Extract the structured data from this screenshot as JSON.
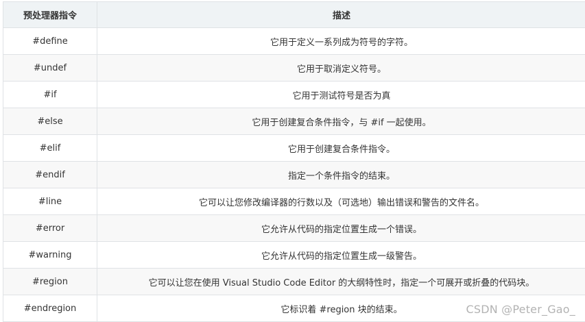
{
  "table": {
    "headers": [
      "预处理器指令",
      "描述"
    ],
    "rows": [
      {
        "directive": "#define",
        "description": "它用于定义一系列成为符号的字符。"
      },
      {
        "directive": "#undef",
        "description": "它用于取消定义符号。"
      },
      {
        "directive": "#if",
        "description": "它用于测试符号是否为真"
      },
      {
        "directive": "#else",
        "description": "它用于创建复合条件指令，与 #if 一起使用。"
      },
      {
        "directive": "#elif",
        "description": "它用于创建复合条件指令。"
      },
      {
        "directive": "#endif",
        "description": "指定一个条件指令的结束。"
      },
      {
        "directive": "#line",
        "description": "它可以让您修改编译器的行数以及（可选地）输出错误和警告的文件名。"
      },
      {
        "directive": "#error",
        "description": "它允许从代码的指定位置生成一个错误。"
      },
      {
        "directive": "#warning",
        "description": "它允许从代码的指定位置生成一级警告。"
      },
      {
        "directive": "#region",
        "description": "它可以让您在使用 Visual Studio Code Editor 的大纲特性时，指定一个可展开或折叠的代码块。"
      },
      {
        "directive": "#endregion",
        "description": "它标识着 #region 块的结束。"
      }
    ]
  },
  "watermark": "CSDN @Peter_Gao_"
}
